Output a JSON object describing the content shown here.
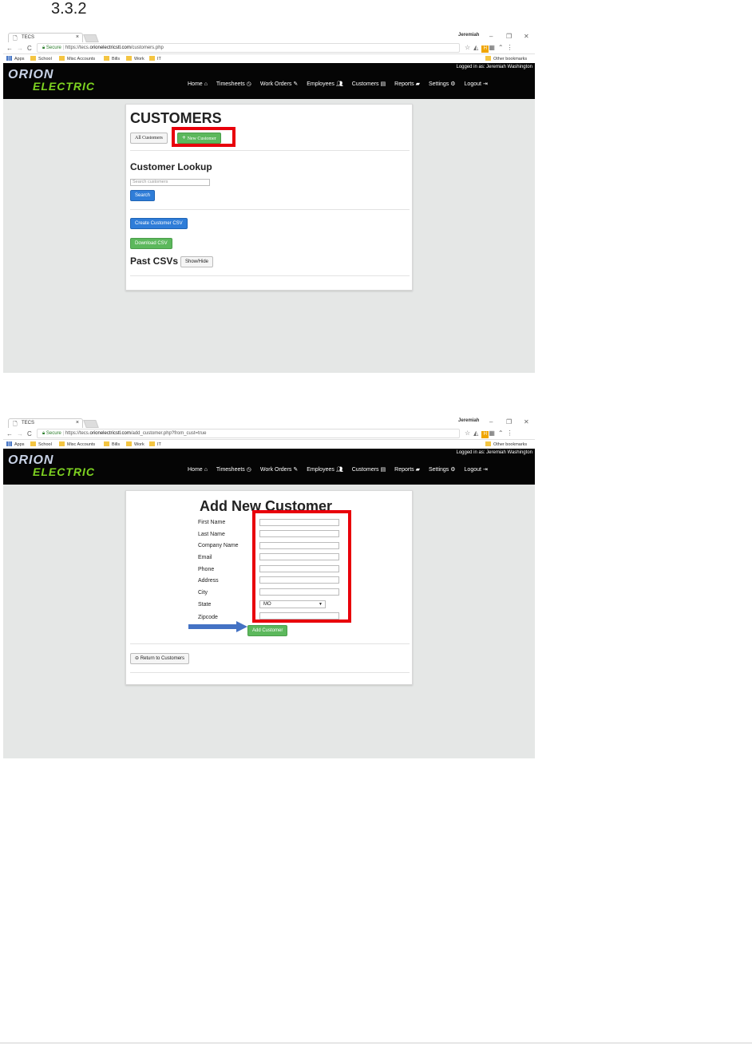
{
  "section_number": "3.3.2",
  "browser": {
    "tab_title": "TECS",
    "tab_close": "×",
    "profile_name": "Jeremiah",
    "window_min": "–",
    "window_restore": "❐",
    "window_close": "✕",
    "secure_label": "Secure",
    "url1_prefix": "https://tecs.",
    "url1_domain": "orionelectricstl.com",
    "url1_path": "/customers.php",
    "url2_prefix": "https://tecs.",
    "url2_domain": "orionelectricstl.com",
    "url2_path": "/add_customer.php?from_cust=true",
    "bookmarks": [
      "Apps",
      "School",
      "Misc Accounts",
      "Bills",
      "Work",
      "IT"
    ],
    "other_bookmarks": "Other bookmarks"
  },
  "header": {
    "logo_line1": "ORION",
    "logo_line2": "ELECTRIC",
    "logged_in": "Logged in as: Jeremiah Washington",
    "menu": [
      "Home",
      "Timesheets",
      "Work Orders",
      "Employees",
      "Customers",
      "Reports",
      "Settings",
      "Logout"
    ]
  },
  "customers_page": {
    "title": "CUSTOMERS",
    "all_customers": "All Customers",
    "new_customer": "New Customer",
    "lookup_title": "Customer Lookup",
    "search_placeholder": "Search customers",
    "search_button": "Search",
    "create_csv": "Create Customer CSV",
    "download_csv": "Download CSV",
    "past_csvs": "Past CSVs",
    "show_hide": "Show/Hide"
  },
  "add_customer_page": {
    "title": "Add New Customer",
    "labels": [
      "First Name",
      "Last Name",
      "Company Name",
      "Email",
      "Phone",
      "Address",
      "City",
      "State",
      "Zipcode"
    ],
    "state_value": "MO",
    "submit": "Add Customer",
    "return": "Return to Customers"
  },
  "colors": {
    "highlight": "#e8000b",
    "arrow": "#4472c4",
    "green_button": "#5cb85c",
    "blue_button": "#2f7dd8"
  }
}
